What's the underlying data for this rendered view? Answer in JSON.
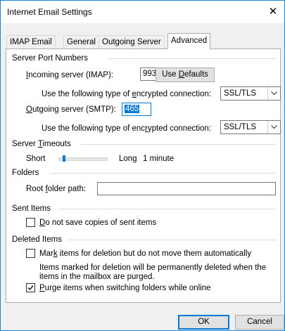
{
  "window": {
    "title": "Internet Email Settings",
    "close_glyph": "✕"
  },
  "tabs": [
    {
      "label": "IMAP Email",
      "active": false
    },
    {
      "label": "General",
      "active": false
    },
    {
      "label": "Outgoing Server",
      "active": false
    },
    {
      "label": "Advanced",
      "active": true
    }
  ],
  "server_ports": {
    "group_label": "Server Port Numbers",
    "incoming_label_pre": "",
    "incoming_label_key": "I",
    "incoming_label_post": "ncoming server (IMAP):",
    "incoming_value": "993",
    "use_defaults_pre": "Use ",
    "use_defaults_key": "D",
    "use_defaults_post": "efaults",
    "incoming_enc_pre": "Use the following type of ",
    "incoming_enc_key": "e",
    "incoming_enc_post": "ncrypted connection:",
    "incoming_enc_value": "SSL/TLS",
    "outgoing_label_pre": "",
    "outgoing_label_key": "O",
    "outgoing_label_post": "utgoing server (SMTP):",
    "outgoing_value": "465",
    "outgoing_enc_pre": "Use the following type of enc",
    "outgoing_enc_key": "r",
    "outgoing_enc_post": "ypted connection:",
    "outgoing_enc_value": "SSL/TLS"
  },
  "timeouts": {
    "group_label_pre": "Server ",
    "group_label_key": "T",
    "group_label_post": "imeouts",
    "short_label": "Short",
    "long_label": "Long",
    "value_label": "1 minute",
    "slider_position_fraction": 0.12
  },
  "folders": {
    "group_label": "Folders",
    "root_label_pre": "Root ",
    "root_label_key": "f",
    "root_label_post": "older path:",
    "root_value": ""
  },
  "sent_items": {
    "group_label": "Sent Items",
    "no_copies_key": "D",
    "no_copies_post": "o not save copies of sent items",
    "no_copies_checked": false
  },
  "deleted_items": {
    "group_label": "Deleted Items",
    "mark_pre": "Mar",
    "mark_key": "k",
    "mark_post": " items for deletion but do not move them automatically",
    "mark_checked": false,
    "note_line1": "Items marked for deletion will be permanently deleted when the",
    "note_line2": "items in the mailbox are purged.",
    "purge_key": "P",
    "purge_post": "urge items when switching folders while online",
    "purge_checked": true
  },
  "buttons": {
    "ok": "OK",
    "cancel": "Cancel"
  }
}
